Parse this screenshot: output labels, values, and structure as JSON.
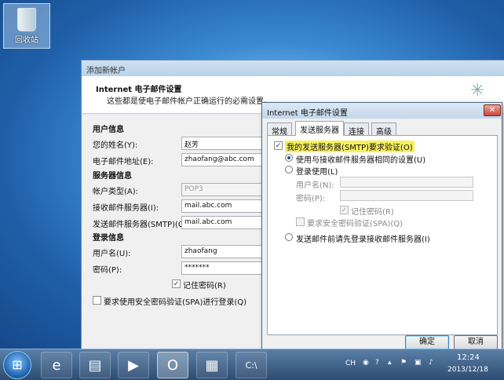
{
  "desktop": {
    "recycle_bin_label": "回收站"
  },
  "main_window": {
    "title": "添加新帐户",
    "header_title": "Internet 电子邮件设置",
    "header_subtitle": "这些都是使电子邮件帐户正确运行的必需设置。",
    "user_info": {
      "section": "用户信息",
      "name_label": "您的姓名(Y):",
      "name_value": "赵芳",
      "email_label": "电子邮件地址(E):",
      "email_value": "zhaofang@abc.com"
    },
    "server_info": {
      "section": "服务器信息",
      "account_type_label": "帐户类型(A):",
      "account_type_value": "POP3",
      "incoming_label": "接收邮件服务器(I):",
      "incoming_value": "mail.abc.com",
      "outgoing_label": "发送邮件服务器(SMTP)(O):",
      "outgoing_value": "mail.abc.com"
    },
    "login_info": {
      "section": "登录信息",
      "username_label": "用户名(U):",
      "username_value": "zhaofang",
      "password_label": "密码(P):",
      "password_value": "*******",
      "remember_label": "记住密码(R)",
      "remember_checked": true,
      "spa_label": "要求使用安全密码验证(SPA)进行登录(Q)",
      "spa_checked": false
    }
  },
  "dialog": {
    "title": "Internet 电子邮件设置",
    "close_glyph": "✕",
    "tabs": [
      "常规",
      "发送服务器",
      "连接",
      "高级"
    ],
    "active_tab": "发送服务器",
    "smtp_auth_label": "我的发送服务器(SMTP)要求验证(O)",
    "smtp_auth_checked": true,
    "radio_same_label": "使用与接收邮件服务器相同的设置(U)",
    "radio_login_label": "登录使用(L)",
    "username_label": "用户名(N):",
    "password_label": "密码(P):",
    "remember_label": "记住密码(R)",
    "spa_label": "要求安全密码验证(SPA)(Q)",
    "radio_pre_login_label": "发送邮件前请先登录接收邮件服务器(I)",
    "ok_label": "确定",
    "cancel_label": "取消"
  },
  "taskbar": {
    "language": "CH",
    "time": "12:24",
    "date": "2013/12/18",
    "pinned_icons": [
      "start-orb-icon",
      "internet-explorer-icon",
      "folder-icon",
      "media-player-icon",
      "outlook-icon",
      "control-panel-icon",
      "command-prompt-icon"
    ]
  }
}
